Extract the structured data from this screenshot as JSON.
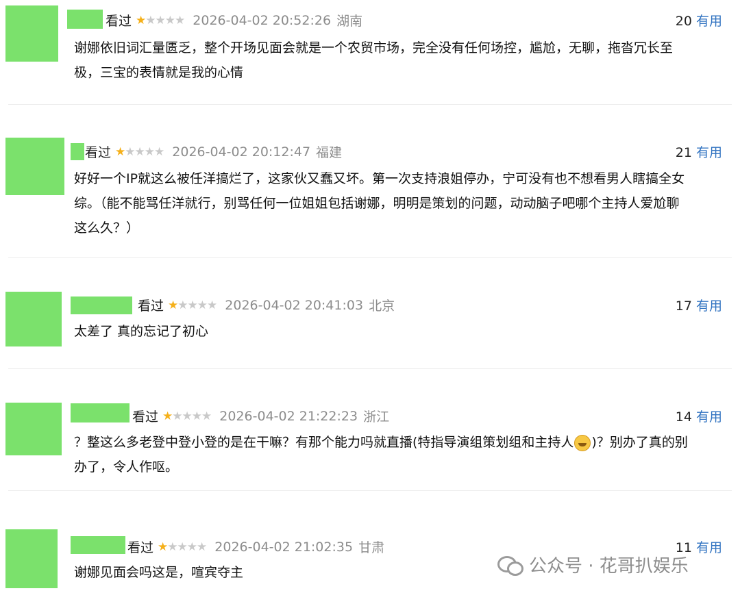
{
  "reviews": [
    {
      "status": "看过",
      "rating": 1,
      "time": "2026-04-02 20:52:26",
      "location": "湖南",
      "votes": "20",
      "useful_label": "有用",
      "lines": [
        "谢娜依旧词汇量匮乏，整个开场见面会就是一个农贸市场，完全没有任何场控，尴尬，无聊，拖沓冗长至",
        "极，三宝的表情就是我的心情"
      ]
    },
    {
      "status": "看过",
      "rating": 1,
      "time": "2026-04-02 20:12:47",
      "location": "福建",
      "votes": "21",
      "useful_label": "有用",
      "lines": [
        "好好一个IP就这么被任洋搞烂了，这家伙又蠢又坏。第一次支持浪姐停办，宁可没有也不想看男人瞎搞全女",
        "综。（能不能骂任洋就行，别骂任何一位姐姐包括谢娜，明明是策划的问题，动动脑子吧哪个主持人爱尬聊",
        "这么久？）"
      ]
    },
    {
      "status": "看过",
      "rating": 1,
      "time": "2026-04-02 20:41:03",
      "location": "北京",
      "votes": "17",
      "useful_label": "有用",
      "lines": [
        "太差了 真的忘记了初心"
      ]
    },
    {
      "status": "看过",
      "rating": 1,
      "time": "2026-04-02 21:22:23",
      "location": "浙江",
      "votes": "14",
      "useful_label": "有用",
      "line1_before": "？整这么多老登中登小登的是在干嘛？有那个能力吗就直播(特指导演组策划组和主持人",
      "line1_after": ")？别办了真的别",
      "line2": "办了，令人作呕。"
    },
    {
      "status": "看过",
      "rating": 1,
      "time": "2026-04-02 21:02:35",
      "location": "甘肃",
      "votes": "11",
      "useful_label": "有用",
      "lines": [
        "谢娜见面会吗这是，喧宾夺主"
      ]
    }
  ],
  "watermark": {
    "text": "公众号 · 花哥扒娱乐"
  },
  "colors": {
    "avatar": "#7be16c",
    "star_on": "#f5b01a",
    "star_off": "#c9c9c9",
    "useful": "#3475c2"
  }
}
